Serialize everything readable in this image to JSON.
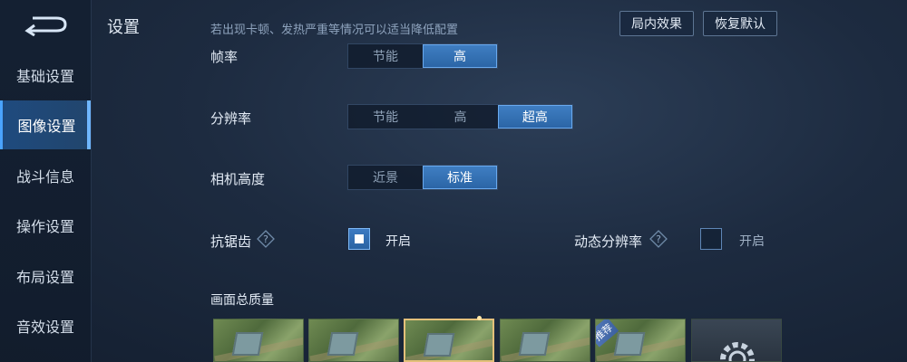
{
  "header": {
    "title": "设置",
    "hint": "若出现卡顿、发热严重等情况可以适当降低配置",
    "btn_in_game_effect": "局内效果",
    "btn_restore_default": "恢复默认"
  },
  "sidebar": {
    "items": [
      {
        "label": "基础设置",
        "active": false
      },
      {
        "label": "图像设置",
        "active": true
      },
      {
        "label": "战斗信息",
        "active": false
      },
      {
        "label": "操作设置",
        "active": false
      },
      {
        "label": "布局设置",
        "active": false
      },
      {
        "label": "音效设置",
        "active": false
      }
    ]
  },
  "settings": {
    "frame_rate": {
      "label": "帧率",
      "options": [
        "节能",
        "高"
      ],
      "selected": "高"
    },
    "resolution": {
      "label": "分辨率",
      "options": [
        "节能",
        "高",
        "超高"
      ],
      "selected": "超高"
    },
    "camera_height": {
      "label": "相机高度",
      "options": [
        "近景",
        "标准"
      ],
      "selected": "标准"
    },
    "anti_aliasing": {
      "label": "抗锯齿",
      "toggle_label": "开启",
      "checked": true
    },
    "dynamic_resolution": {
      "label": "动态分辨率",
      "toggle_label": "开启",
      "checked": false
    },
    "overall_quality": {
      "label": "画面总质量",
      "recommended_badge": "推荐",
      "selected_index": 2
    }
  },
  "colors": {
    "accent": "#3f7ec2",
    "selected_border": "#e3c07a"
  }
}
